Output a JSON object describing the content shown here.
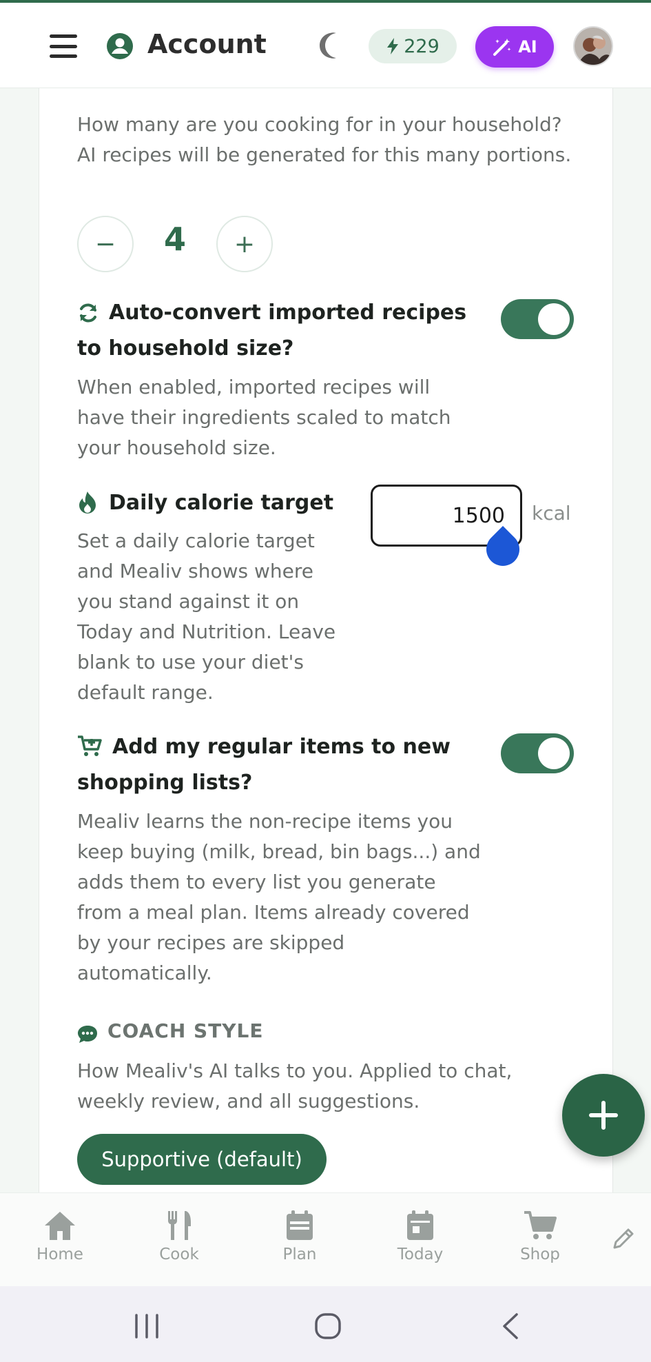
{
  "header": {
    "title": "Account",
    "credits": "229",
    "ai_label": "AI",
    "menu_icon": "hamburger-menu-icon",
    "theme_icon": "moon-icon"
  },
  "household": {
    "description": "How many are you cooking for in your household? AI recipes will be generated for this many portions.",
    "minus_label": "−",
    "plus_label": "+",
    "count": "4"
  },
  "auto_convert": {
    "title": "Auto-convert imported recipes to household size?",
    "description": "When enabled, imported recipes will have their ingredients scaled to match your household size.",
    "enabled": true
  },
  "calorie": {
    "title": "Daily calorie target",
    "description": "Set a daily calorie target and Mealiv shows where you stand against it on Today and Nutrition. Leave blank to use your diet's default range.",
    "value": "1500",
    "unit": "kcal"
  },
  "regular_items": {
    "title": "Add my regular items to new shopping lists?",
    "description": "Mealiv learns the non-recipe items you keep buying (milk, bread, bin bags...) and adds them to every list you generate from a meal plan. Items already covered by your recipes are skipped automatically.",
    "enabled": true
  },
  "coach": {
    "label": "COACH STYLE",
    "description": "How Mealiv's AI talks to you. Applied to chat, weekly review, and all suggestions.",
    "selected": "Supportive (default)"
  },
  "nav": [
    {
      "label": "Home",
      "icon": "home-icon"
    },
    {
      "label": "Cook",
      "icon": "utensils-icon"
    },
    {
      "label": "Plan",
      "icon": "calendar-icon"
    },
    {
      "label": "Today",
      "icon": "calendar-today-icon"
    },
    {
      "label": "Shop",
      "icon": "cart-icon"
    }
  ],
  "colors": {
    "brand": "#2f6b4c",
    "ai_purple": "#9b35f0",
    "toggle_on": "#39775a"
  }
}
